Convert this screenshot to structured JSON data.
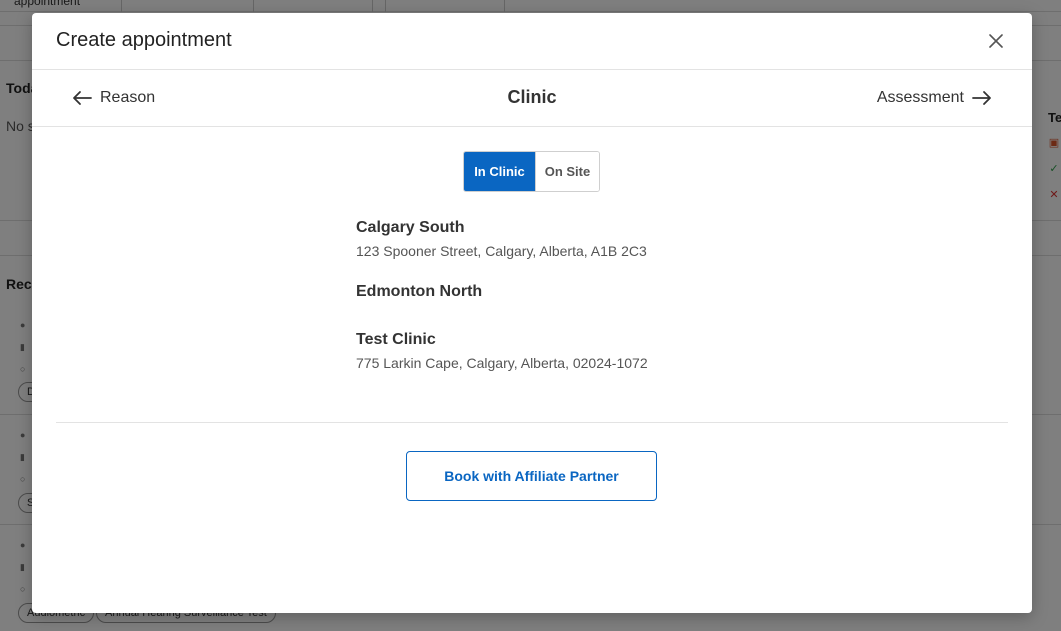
{
  "background": {
    "top_tab_text": "appointment",
    "today_title": "Toda",
    "today_empty": "No s",
    "recent_title": "Rec",
    "right_title": "Te",
    "chips": [
      {
        "label": "D"
      },
      {
        "label": "S"
      },
      {
        "label": "Audiometric"
      },
      {
        "label": "Annual Hearing Surveillance Test"
      }
    ]
  },
  "modal": {
    "title": "Create appointment",
    "close_icon": "close-icon",
    "steps": {
      "prev_label": "Reason",
      "current_label": "Clinic",
      "next_label": "Assessment"
    },
    "location_toggle": {
      "options": [
        "In Clinic",
        "On Site"
      ],
      "selected": "In Clinic",
      "accent_color": "#0a66c2"
    },
    "clinics": [
      {
        "name": "Calgary South",
        "address": "123 Spooner Street, Calgary, Alberta, A1B 2C3"
      },
      {
        "name": "Edmonton North",
        "address": ""
      },
      {
        "name": "Test Clinic",
        "address": "775 Larkin Cape, Calgary, Alberta, 02024-1072"
      }
    ],
    "affiliate_button": "Book with Affiliate Partner"
  }
}
